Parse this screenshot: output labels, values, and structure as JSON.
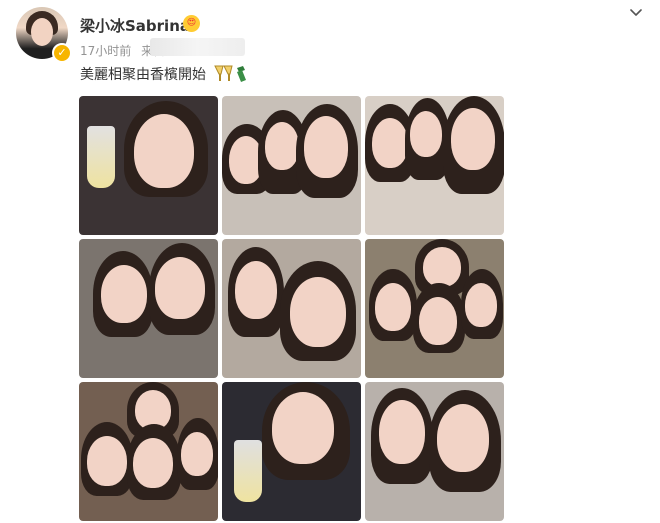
{
  "post": {
    "username": "梁小冰Sabrina",
    "time": "17小时前",
    "source_prefix": "来自",
    "text": "美麗相聚由香檳開始",
    "verified_symbol": "✓",
    "emoji": "😍"
  },
  "photos": [
    {
      "label": "photo-1",
      "bg": "#3b3334"
    },
    {
      "label": "photo-2",
      "bg": "#c8c0b8"
    },
    {
      "label": "photo-3",
      "bg": "#d8cfc6"
    },
    {
      "label": "photo-4",
      "bg": "#7b746e"
    },
    {
      "label": "photo-5",
      "bg": "#b3a99f"
    },
    {
      "label": "photo-6",
      "bg": "#8c806f"
    },
    {
      "label": "photo-7",
      "bg": "#735f51"
    },
    {
      "label": "photo-8",
      "bg": "#2c2b32"
    },
    {
      "label": "photo-9",
      "bg": "#b8b1ab"
    }
  ],
  "colors": {
    "username": "#333333",
    "meta": "#939393",
    "badge": "#f7b500"
  }
}
